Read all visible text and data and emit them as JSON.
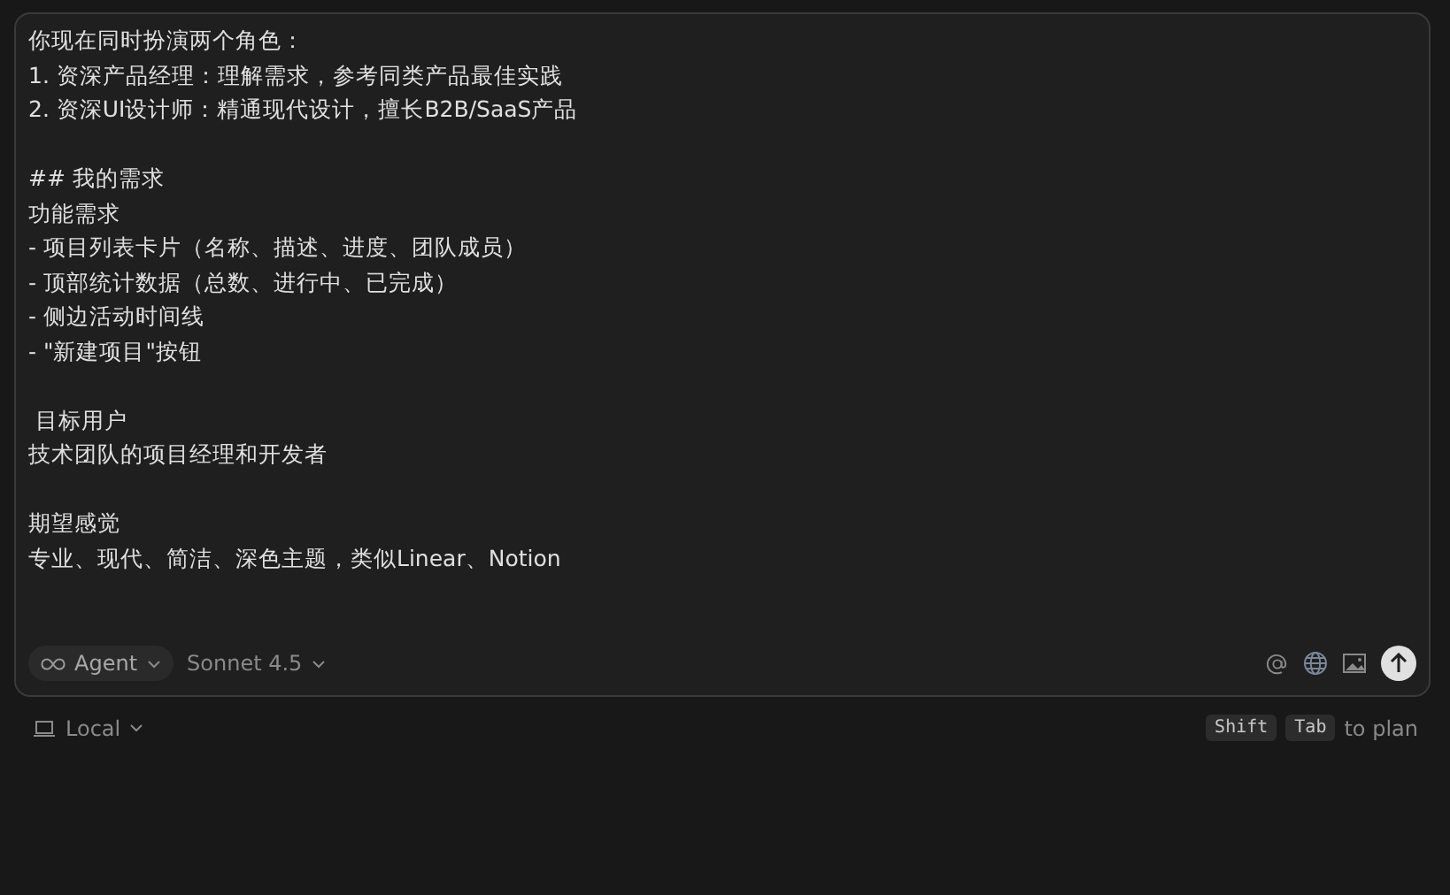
{
  "prompt": {
    "paragraphs": [
      [
        "你现在同时扮演两个角色：",
        "1. 资深产品经理：理解需求，参考同类产品最佳实践",
        "2. 资深UI设计师：精通现代设计，擅长B2B/SaaS产品"
      ],
      [
        "## 我的需求",
        "功能需求",
        "- 项目列表卡片（名称、描述、进度、团队成员）",
        "- 顶部统计数据（总数、进行中、已完成）",
        "- 侧边活动时间线",
        "- \"新建项目\"按钮"
      ],
      [
        " 目标用户",
        "技术团队的项目经理和开发者"
      ],
      [
        "期望感觉",
        "专业、现代、简洁、深色主题，类似Linear、Notion"
      ]
    ]
  },
  "toolbar": {
    "mode": "Agent",
    "model": "Sonnet 4.5"
  },
  "footer": {
    "location": "Local",
    "keys": [
      "Shift",
      "Tab"
    ],
    "hint": "to plan"
  }
}
